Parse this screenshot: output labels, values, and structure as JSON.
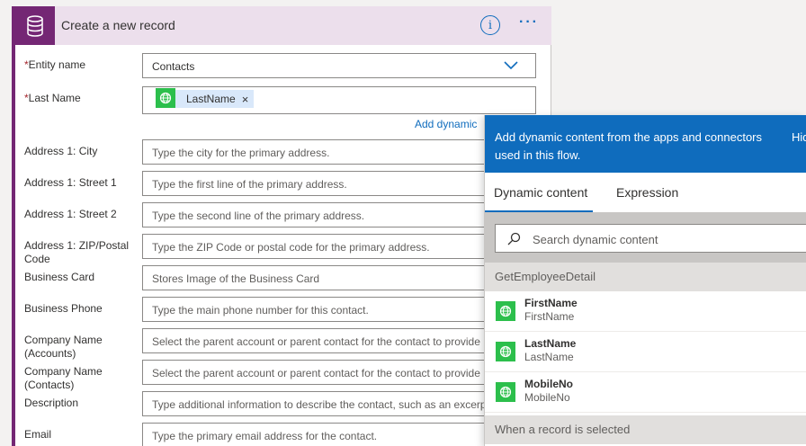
{
  "card": {
    "title": "Create a new record",
    "info_icon": "i",
    "more_icon": "···"
  },
  "fields": [
    {
      "label": "Entity name",
      "required": "*",
      "value": "Contacts"
    },
    {
      "label": "Last Name",
      "required": "*",
      "token": "LastName",
      "token_close": "×"
    },
    {
      "label": "Address 1: City",
      "placeholder": "Type the city for the primary address."
    },
    {
      "label": "Address 1: Street 1",
      "placeholder": "Type the first line of the primary address."
    },
    {
      "label": "Address 1: Street 2",
      "placeholder": "Type the second line of the primary address."
    },
    {
      "label": "Address 1: ZIP/Postal Code",
      "placeholder": "Type the ZIP Code or postal code for the primary address."
    },
    {
      "label": "Business Card",
      "placeholder": "Stores Image of the Business Card"
    },
    {
      "label": "Business Phone",
      "placeholder": "Type the main phone number for this contact."
    },
    {
      "label": "Company Name (Accounts)",
      "placeholder": "Select the parent account or parent contact for the contact to provide"
    },
    {
      "label": "Company Name (Contacts)",
      "placeholder": "Select the parent account or parent contact for the contact to provide"
    },
    {
      "label": "Description",
      "placeholder": "Type additional information to describe the contact, such as an excerp"
    },
    {
      "label": "Email",
      "placeholder": "Type the primary email address for the contact."
    }
  ],
  "add_dynamic_link": "Add dynamic",
  "panel": {
    "header_text": "Add dynamic content from the apps and connectors used in this flow.",
    "hide_label": "Hid",
    "tabs": [
      "Dynamic content",
      "Expression"
    ],
    "search_placeholder": "Search dynamic content",
    "group1": "GetEmployeeDetail",
    "items": [
      {
        "title": "FirstName",
        "subtitle": "FirstName"
      },
      {
        "title": "LastName",
        "subtitle": "LastName"
      },
      {
        "title": "MobileNo",
        "subtitle": "MobileNo"
      }
    ],
    "group2": "When a record is selected"
  },
  "colors": {
    "brand": "#742774",
    "header_bg": "#ecdfec",
    "accent": "#0f6cbd",
    "connector_green": "#2cbf4c"
  },
  "icons": {
    "card": "database-icon",
    "token": "globe-icon",
    "search": "search-icon",
    "dropdown": "chevron-down-icon"
  }
}
